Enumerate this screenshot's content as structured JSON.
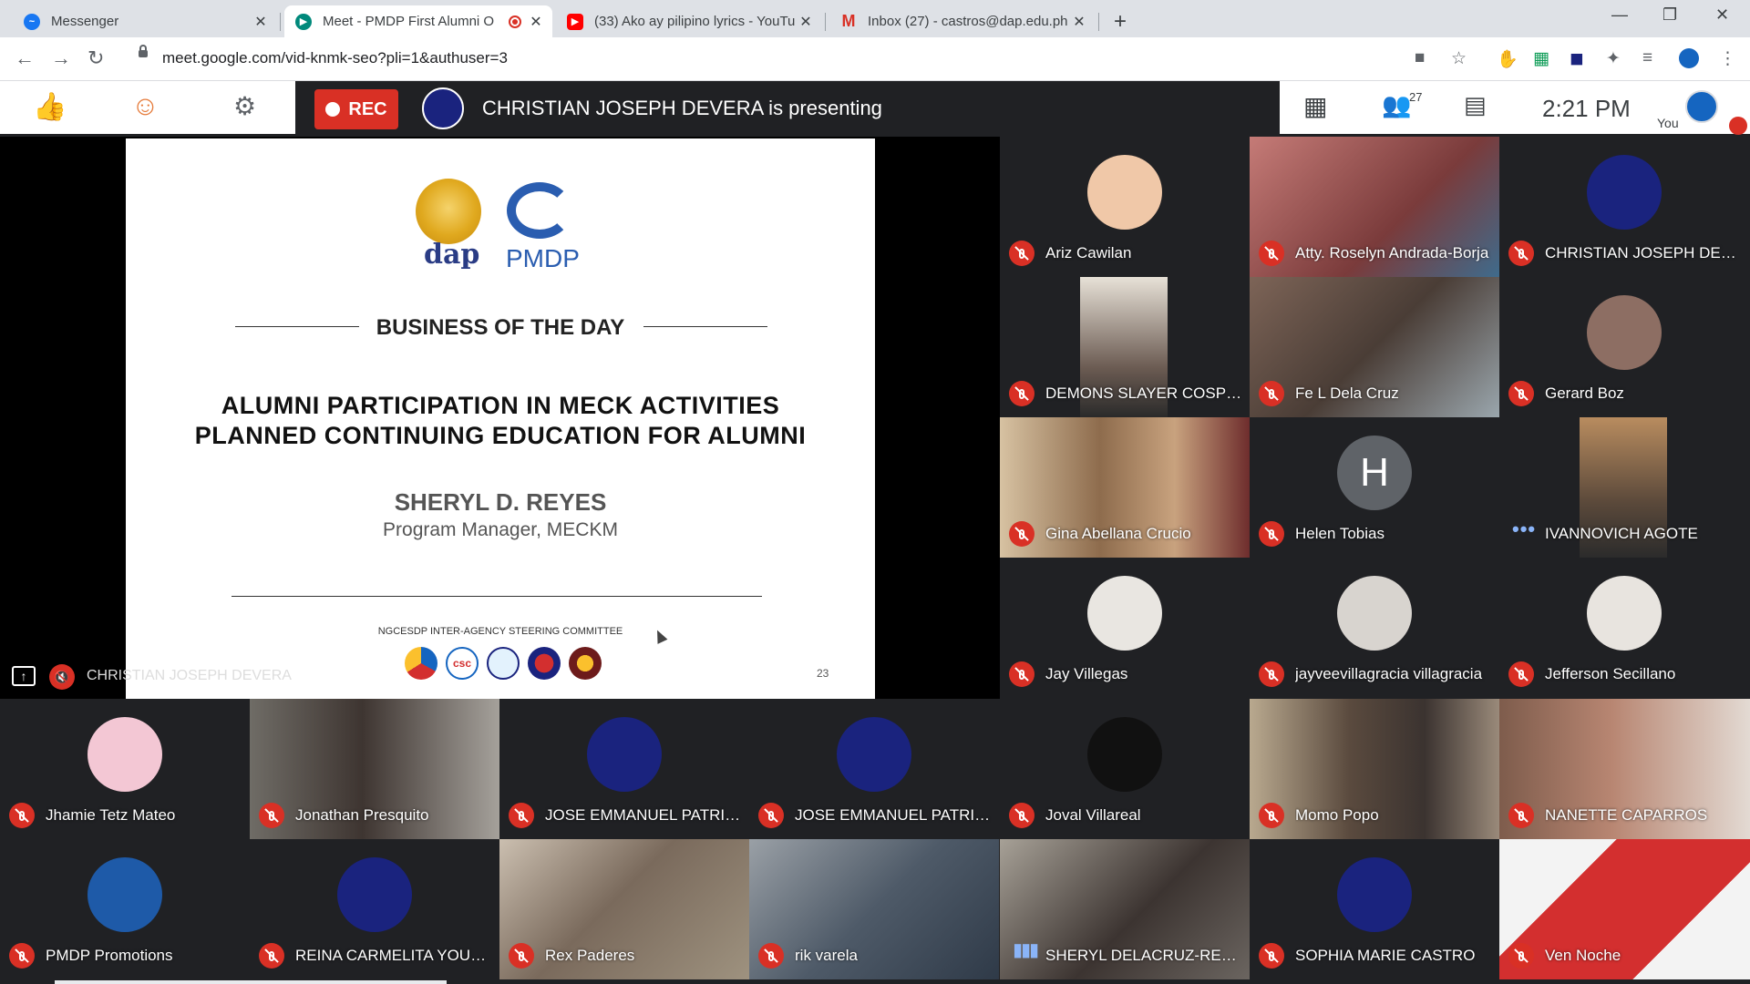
{
  "browser": {
    "tabs": [
      {
        "title": "Messenger",
        "favicon_color": "#1877f2",
        "active": false
      },
      {
        "title": "Meet - PMDP First Alumni O",
        "favicon_color": "#00897b",
        "active": true
      },
      {
        "title": "(33) Ako ay pilipino lyrics - YouTu",
        "favicon_color": "#ff0000",
        "active": false
      },
      {
        "title": "Inbox (27) - castros@dap.edu.ph",
        "favicon_color": "#d93025",
        "active": false
      }
    ],
    "url": "meet.google.com/vid-knmk-seo?pli=1&authuser=3"
  },
  "meet": {
    "rec_label": "REC",
    "presenting_text": "CHRISTIAN JOSEPH DEVERA is presenting",
    "participant_count": "27",
    "time": "2:21 PM",
    "you_label": "You"
  },
  "slide": {
    "dap_text": "dap",
    "pmdp_text": "PMDP",
    "heading": "BUSINESS OF THE DAY",
    "title_line1": "ALUMNI PARTICIPATION IN MECK ACTIVITIES",
    "title_line2": "PLANNED CONTINUING EDUCATION FOR ALUMNI",
    "presenter_name": "SHERYL D. REYES",
    "presenter_role": "Program Manager, MECKM",
    "committee": "NGCESDP INTER-AGENCY STEERING COMMITTEE",
    "page_number": "23",
    "stage_name": "CHRISTIAN JOSEPH DEVERA"
  },
  "participants": [
    {
      "name": "Ariz Cawilan",
      "status": "muted"
    },
    {
      "name": "Atty. Roselyn Andrada-Borja",
      "status": "muted"
    },
    {
      "name": "CHRISTIAN JOSEPH DEVE...",
      "status": "muted"
    },
    {
      "name": "DEMONS SLAYER COSPLA...",
      "status": "muted"
    },
    {
      "name": "Fe L Dela Cruz",
      "status": "muted"
    },
    {
      "name": "Gerard Boz",
      "status": "muted"
    },
    {
      "name": "Gina Abellana Crucio",
      "status": "muted"
    },
    {
      "name": "Helen Tobias",
      "status": "muted",
      "initial": "H"
    },
    {
      "name": "IVANNOVICH AGOTE",
      "status": "dots"
    },
    {
      "name": "Jay Villegas",
      "status": "muted"
    },
    {
      "name": "jayveevillagracia villagracia",
      "status": "muted"
    },
    {
      "name": "Jefferson Secillano",
      "status": "muted"
    },
    {
      "name": "Jhamie Tetz Mateo",
      "status": "muted"
    },
    {
      "name": "Jonathan Presquito",
      "status": "muted"
    },
    {
      "name": "JOSE EMMANUEL PATRIM...",
      "status": "muted"
    },
    {
      "name": "JOSE EMMANUEL PATRIM...",
      "status": "muted"
    },
    {
      "name": "Joval Villareal",
      "status": "muted"
    },
    {
      "name": "Momo Popo",
      "status": "muted"
    },
    {
      "name": "NANETTE CAPARROS",
      "status": "muted"
    },
    {
      "name": "PMDP Promotions",
      "status": "muted"
    },
    {
      "name": "REINA CARMELITA YOUNG",
      "status": "muted"
    },
    {
      "name": "Rex Paderes",
      "status": "muted"
    },
    {
      "name": "rik varela",
      "status": "muted"
    },
    {
      "name": "SHERYL DELACRUZ-REYES",
      "status": "talking"
    },
    {
      "name": "SOPHIA MARIE CASTRO",
      "status": "muted"
    },
    {
      "name": "Ven Noche",
      "status": "muted"
    }
  ],
  "colors": {
    "rec": "#d93025",
    "meet_dark": "#202124",
    "accent_blue": "#1a73e8"
  }
}
